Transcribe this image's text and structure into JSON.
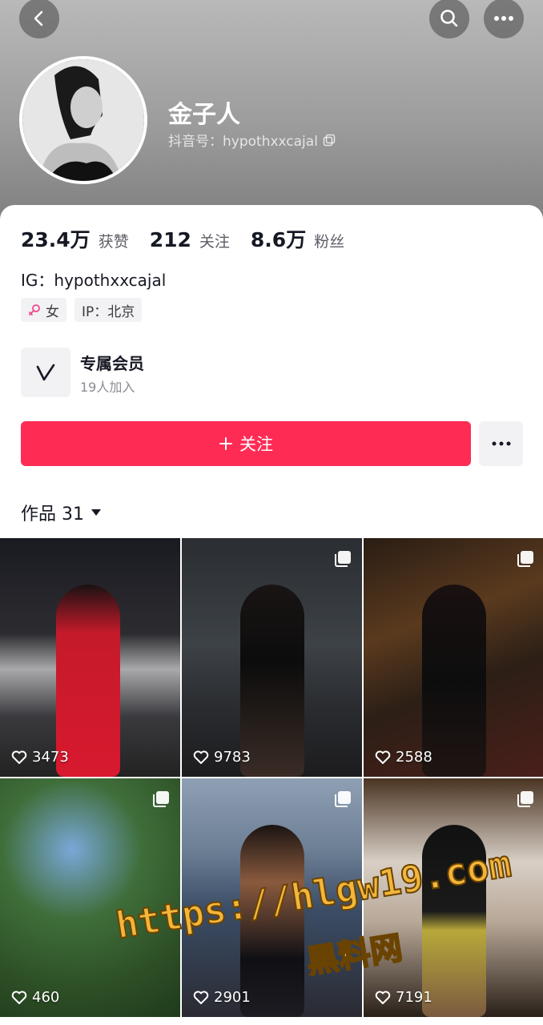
{
  "profile": {
    "nickname": "金子人",
    "douyin_id": "抖音号：hypothxxcajal"
  },
  "stats": [
    {
      "num": "23.4万",
      "label": "获赞"
    },
    {
      "num": "212",
      "label": "关注"
    },
    {
      "num": "8.6万",
      "label": "粉丝"
    }
  ],
  "bio": "IG：hypothxxcajal",
  "tags": {
    "gender": "女",
    "ip": "IP：北京"
  },
  "member": {
    "title": "专属会员",
    "subtitle": "19人加入"
  },
  "actions": {
    "follow_label": "关注"
  },
  "works_tab": {
    "label": "作品 31"
  },
  "tiles": [
    {
      "likes": "3473",
      "multi": false
    },
    {
      "likes": "9783",
      "multi": true
    },
    {
      "likes": "2588",
      "multi": true
    },
    {
      "likes": "460",
      "multi": true
    },
    {
      "likes": "2901",
      "multi": true
    },
    {
      "likes": "7191",
      "multi": true
    }
  ],
  "watermark": {
    "url": "https://hlgw19.com",
    "cn": "黑料网"
  },
  "colors": {
    "accent": "#fe2c55",
    "watermark": "#f2b63c"
  }
}
